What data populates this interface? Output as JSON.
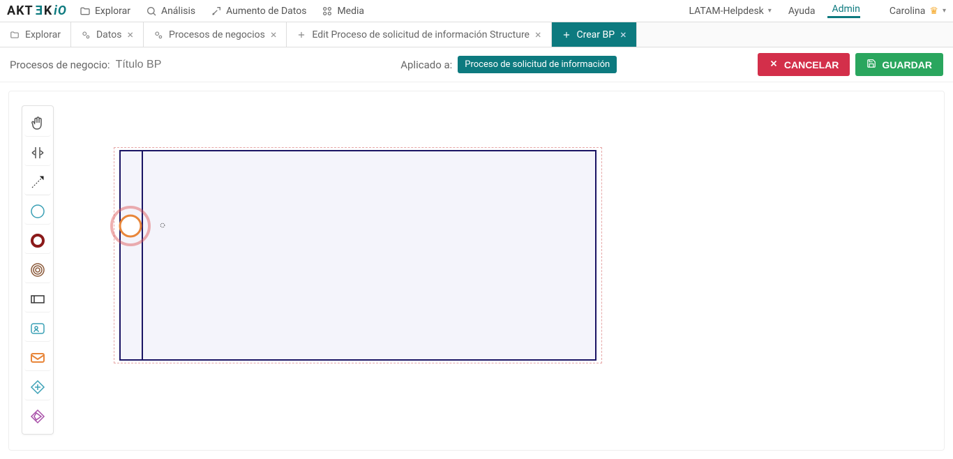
{
  "logo": {
    "text1": "AKT",
    "text2": "E",
    "text3": "K",
    "io": "iO"
  },
  "nav": [
    {
      "icon": "folder",
      "label": "Explorar"
    },
    {
      "icon": "search",
      "label": "Análisis"
    },
    {
      "icon": "augment",
      "label": "Aumento de Datos"
    },
    {
      "icon": "media",
      "label": "Media"
    }
  ],
  "right": {
    "workspace": "LATAM-Helpdesk",
    "help": "Ayuda",
    "admin": "Admin",
    "user": "Carolina"
  },
  "tabs": [
    {
      "icon": "folder",
      "label": "Explorar",
      "closable": false
    },
    {
      "icon": "gears",
      "label": "Datos",
      "closable": true
    },
    {
      "icon": "gears",
      "label": "Procesos de negocios",
      "closable": true
    },
    {
      "icon": "plus",
      "label": "Edit Proceso de solicitud de información Structure",
      "closable": true
    },
    {
      "icon": "plus",
      "label": "Crear BP",
      "closable": true,
      "active": true
    }
  ],
  "actionbar": {
    "label": "Procesos de negocio:",
    "placeholder": "Título BP",
    "applied_label": "Aplicado a:",
    "applied_badge": "Proceso de solicitud de información",
    "cancel": "CANCELAR",
    "save": "GUARDAR"
  },
  "tools": [
    {
      "name": "hand-tool",
      "icon": "hand"
    },
    {
      "name": "align-tool",
      "icon": "align"
    },
    {
      "name": "connect-tool",
      "icon": "connect"
    },
    {
      "name": "start-event-tool",
      "icon": "circle-thin"
    },
    {
      "name": "end-event-tool",
      "icon": "circle-thick"
    },
    {
      "name": "intermediate-event-tool",
      "icon": "circle-nested"
    },
    {
      "name": "lane-tool",
      "icon": "rect"
    },
    {
      "name": "user-task-tool",
      "icon": "user-rect"
    },
    {
      "name": "message-tool",
      "icon": "mail"
    },
    {
      "name": "gateway-tool",
      "icon": "diamond"
    },
    {
      "name": "gateway2-tool",
      "icon": "diamond2"
    }
  ]
}
